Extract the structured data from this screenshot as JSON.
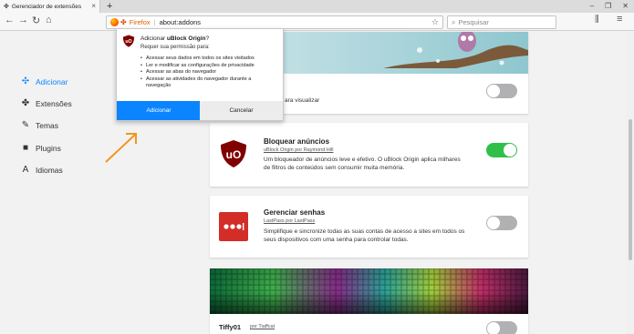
{
  "browser": {
    "tab_title": "Gerenciador de extensões",
    "new_tab_label": "+",
    "url_brand": "Firefox",
    "url": "about:addons",
    "search_placeholder": "Pesquisar"
  },
  "sidebar": {
    "items": [
      {
        "label": "Adicionar",
        "icon": "extension-add-icon",
        "active": true
      },
      {
        "label": "Extensões",
        "icon": "puzzle-icon",
        "active": false
      },
      {
        "label": "Temas",
        "icon": "brush-icon",
        "active": false
      },
      {
        "label": "Plugins",
        "icon": "plugin-icon",
        "active": false
      },
      {
        "label": "Idiomas",
        "icon": "language-icon",
        "active": false
      }
    ]
  },
  "popup": {
    "title_prefix": "Adicionar ",
    "title_name": "uBlock Origin",
    "title_suffix": "?",
    "permission_intro": "Requer sua permissão para:",
    "permissions": [
      "Acessar seus dados em todos os sites visitados",
      "Ler e modificar as configurações de privacidade",
      "Acessar as abas do navegador",
      "Acessar as atividades do navegador durante a navegação"
    ],
    "add_label": "Adicionar",
    "cancel_label": "Cancelar"
  },
  "cards": [
    {
      "title": "",
      "by": "",
      "desc_tail": "ara visualizar",
      "toggle_on": false
    },
    {
      "title": "Bloquear anúncios",
      "by": "uBlock Origin por Raymond Hill",
      "desc": "Um bloqueador de anúncios leve e efetivo. O uBlock Origin aplica milhares de filtros de conteúdos sem consumir muita memória.",
      "toggle_on": true
    },
    {
      "title": "Gerenciar senhas",
      "by": "LastPass por LastPass",
      "desc": "Simplifique e sincronize todas as suas contas de acesso a sites em todos os seus dispositivos com uma senha para controlar todas.",
      "toggle_on": false
    },
    {
      "title": "Tiffy01",
      "by": "por Tiaffcat",
      "toggle_on": false
    }
  ],
  "colors": {
    "accent": "#0a84ff",
    "toggle_on": "#30c04a",
    "toggle_off": "#b1b1b3",
    "ublock_red": "#800000",
    "lastpass_red": "#d32d27",
    "arrow_orange": "#f0961e"
  }
}
